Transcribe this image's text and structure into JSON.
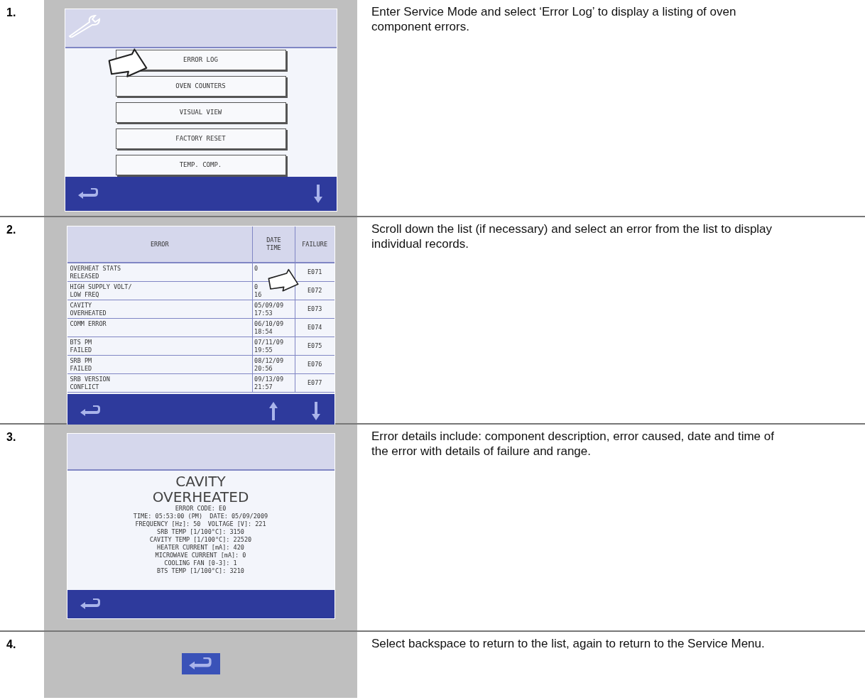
{
  "steps": [
    {
      "number": "1.",
      "text": "Enter Service Mode and select ‘Error Log’ to display a listing of oven component errors.",
      "screen": {
        "kind": "menu",
        "items": [
          "ERROR LOG",
          "OVEN COUNTERS",
          "VISUAL VIEW",
          "FACTORY RESET",
          "TEMP. COMP."
        ]
      }
    },
    {
      "number": "2.",
      "text": "Scroll down the list (if necessary) and select an error from the list to display individual records.",
      "screen": {
        "kind": "table",
        "columns": [
          "ERROR",
          "DATE\nTIME",
          "FAILURE"
        ],
        "rows": [
          {
            "error": "OVERHEAT STATS\nRELEASED",
            "date_time": "0",
            "failure": "E071"
          },
          {
            "error": "HIGH SUPPLY VOLT/\nLOW FREQ",
            "date_time": "0\n16",
            "failure": "E072"
          },
          {
            "error": "CAVITY\nOVERHEATED",
            "date_time": "05/09/09\n17:53",
            "failure": "E073"
          },
          {
            "error": "COMM ERROR",
            "date_time": "06/10/09\n18:54",
            "failure": "E074"
          },
          {
            "error": "BTS PM\nFAILED",
            "date_time": "07/11/09\n19:55",
            "failure": "E075"
          },
          {
            "error": "SRB PM\nFAILED",
            "date_time": "08/12/09\n20:56",
            "failure": "E076"
          },
          {
            "error": "SRB VERSION\nCONFLICT",
            "date_time": "09/13/09\n21:57",
            "failure": "E077"
          }
        ]
      }
    },
    {
      "number": "3.",
      "text": "Error details include: component description, error caused, date and time of the error with details of failure and range.",
      "screen": {
        "kind": "detail",
        "title": [
          "CAVITY",
          "OVERHEATED"
        ],
        "lines": [
          "ERROR CODE: E0",
          "TIME: 05:53:00 (PM)  DATE: 05/09/2009",
          "FREQUENCY [Hz]: 50  VOLTAGE [V]: 221",
          "SRB TEMP [1/100°C]: 3150",
          "CAVITY TEMP [1/100°C]: 22520",
          "HEATER CURRENT [mA]: 420",
          "MICROWAVE CURRENT [mA]: 0",
          "COOLING FAN [0-3]: 1",
          "BTS TEMP [1/100°C]: 3210"
        ]
      }
    },
    {
      "number": "4.",
      "text": "Select backspace to return to the list, again to return to the Service Menu.",
      "screen": {
        "kind": "button"
      }
    }
  ]
}
